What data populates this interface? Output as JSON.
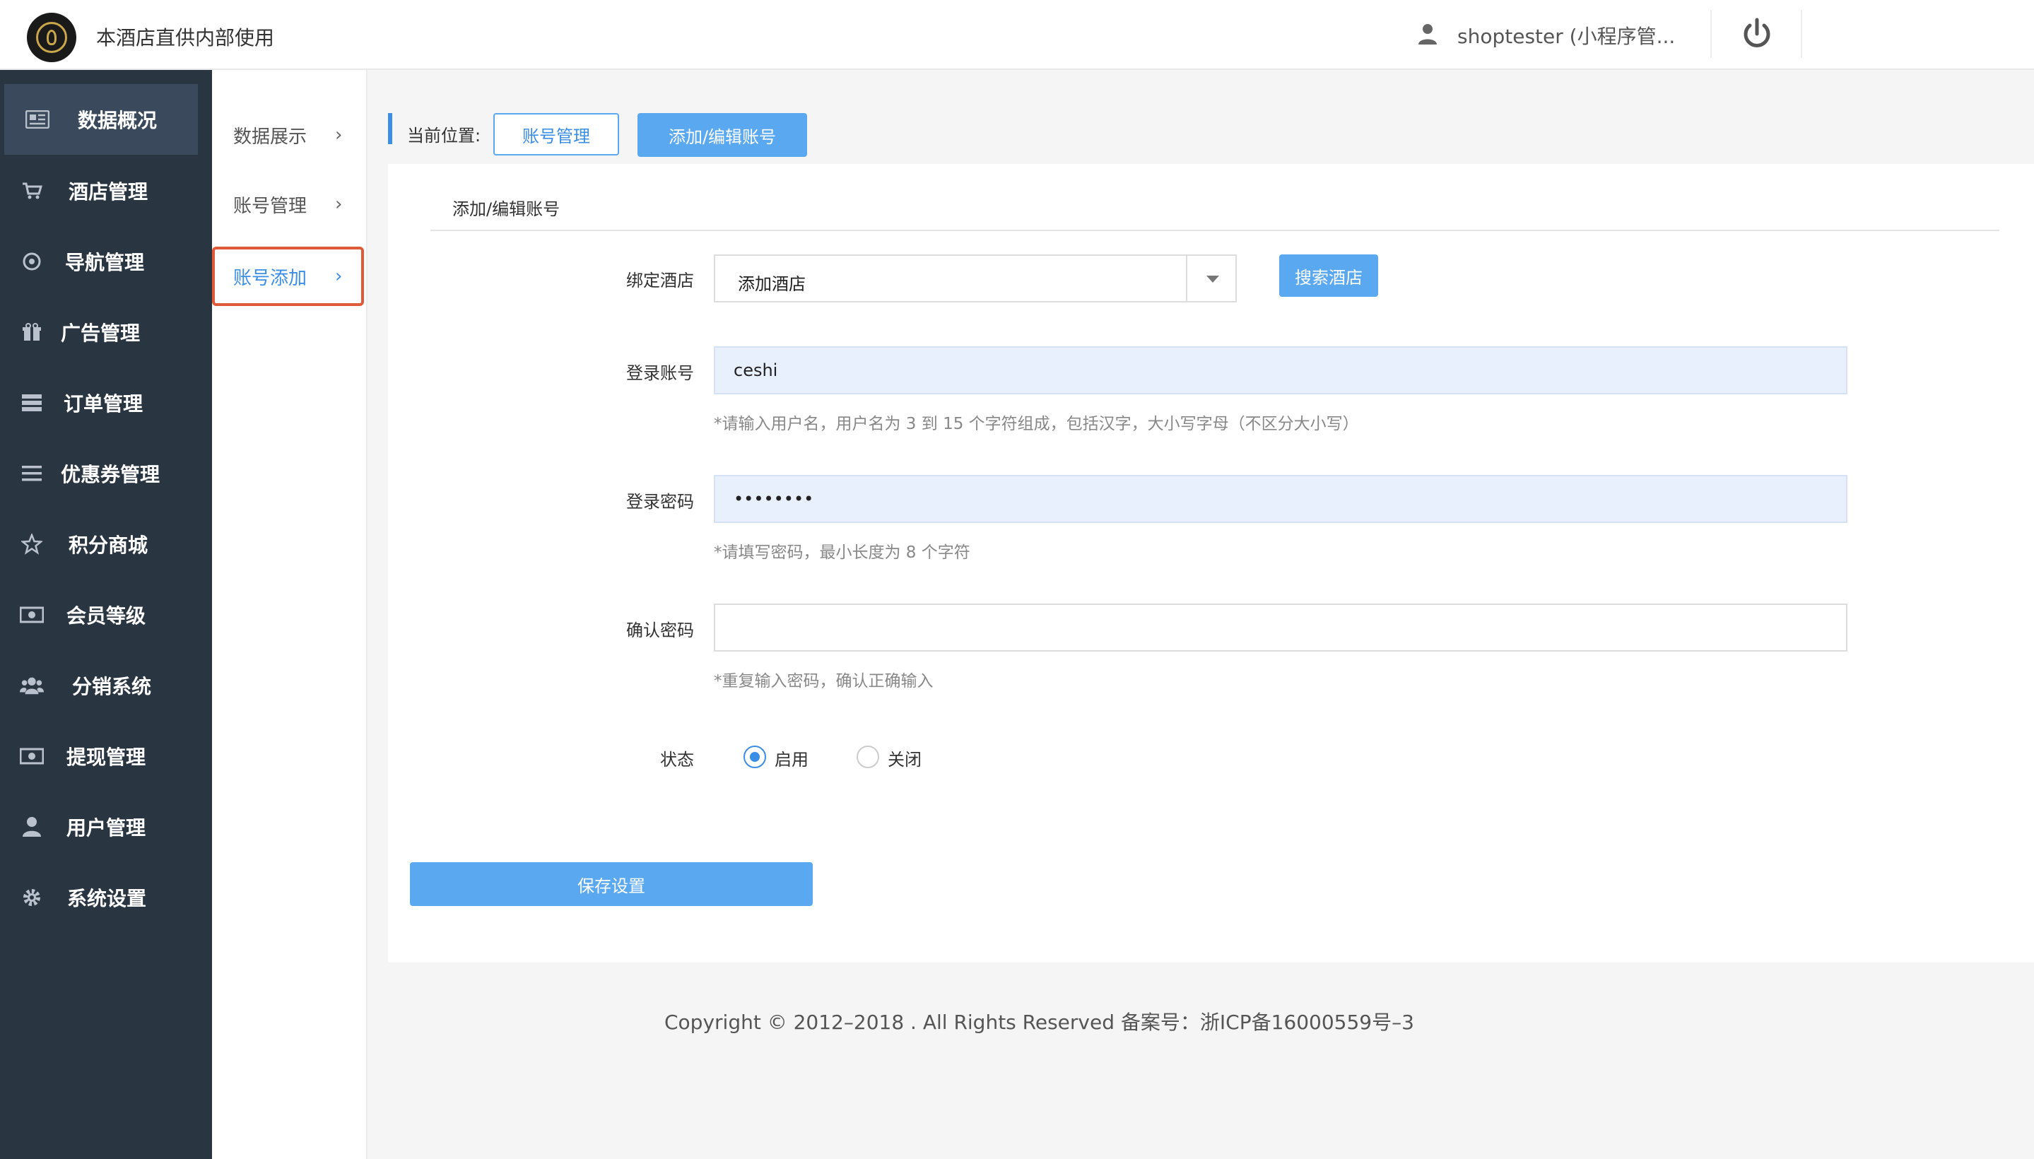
{
  "header": {
    "site_title": "本酒店直供内部使用",
    "user_name": "shoptester (小程序管..."
  },
  "sidebar": {
    "items": [
      {
        "label": "数据概况",
        "icon": "newspaper-icon",
        "active": true
      },
      {
        "label": "酒店管理",
        "icon": "cart-icon"
      },
      {
        "label": "导航管理",
        "icon": "compass-icon"
      },
      {
        "label": "广告管理",
        "icon": "gift-icon"
      },
      {
        "label": "订单管理",
        "icon": "server-icon"
      },
      {
        "label": "优惠券管理",
        "icon": "list-icon"
      },
      {
        "label": "积分商城",
        "icon": "star-icon"
      },
      {
        "label": "会员等级",
        "icon": "money-icon"
      },
      {
        "label": "分销系统",
        "icon": "users-icon"
      },
      {
        "label": "提现管理",
        "icon": "money-icon"
      },
      {
        "label": "用户管理",
        "icon": "user-icon"
      },
      {
        "label": "系统设置",
        "icon": "gear-icon"
      }
    ]
  },
  "submenu": {
    "items": [
      {
        "label": "数据展示"
      },
      {
        "label": "账号管理"
      },
      {
        "label": "账号添加",
        "active": true
      }
    ]
  },
  "breadcrumb": {
    "label": "当前位置:",
    "items": [
      "账号管理",
      "添加/编辑账号"
    ]
  },
  "form": {
    "section_title": "添加/编辑账号",
    "hotel": {
      "label": "绑定酒店",
      "value": "添加酒店",
      "search_button": "搜索酒店"
    },
    "account": {
      "label": "登录账号",
      "value": "ceshi",
      "hint": "*请输入用户名，用户名为 3 到 15 个字符组成，包括汉字，大小写字母（不区分大小写）"
    },
    "password": {
      "label": "登录密码",
      "value": "••••••••",
      "hint": "*请填写密码，最小长度为 8 个字符"
    },
    "confirm": {
      "label": "确认密码",
      "value": "",
      "hint": "*重复输入密码，确认正确输入"
    },
    "status": {
      "label": "状态",
      "options": [
        "启用",
        "关闭"
      ],
      "selected": "启用"
    },
    "save_button": "保存设置"
  },
  "footer": {
    "text": "Copyright © 2012–2018 . All Rights Reserved 备案号：浙ICP备16000559号–3"
  },
  "colors": {
    "sidebar_bg": "#2a3542",
    "accent": "#5aa8f0",
    "highlight_border": "#e05a3a"
  }
}
